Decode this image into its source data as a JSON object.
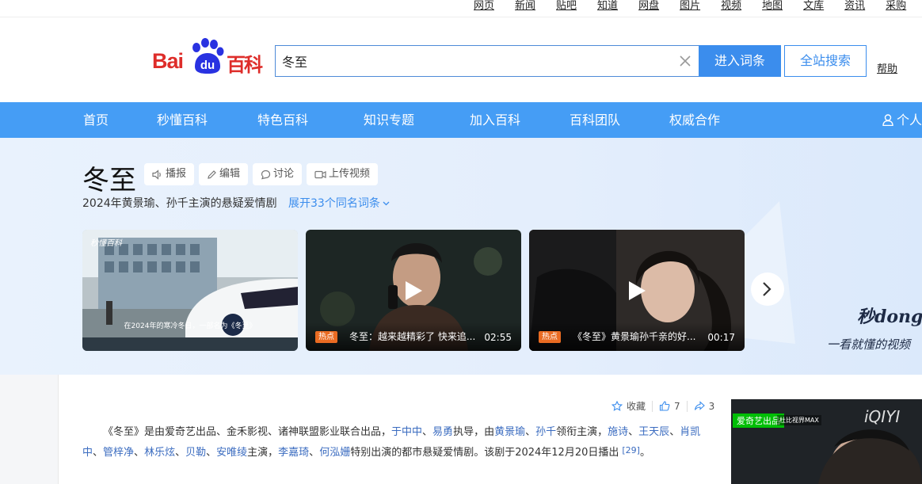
{
  "topnav": {
    "links": [
      "网页",
      "新闻",
      "贴吧",
      "知道",
      "网盘",
      "图片",
      "视频",
      "地图",
      "文库",
      "资讯",
      "采购"
    ]
  },
  "header": {
    "logo_text_left": "Bai",
    "logo_text_paw": "du",
    "logo_text_right": "百科",
    "search_value": "冬至",
    "enter_label": "进入词条",
    "site_search_label": "全站搜索",
    "help_label": "帮助"
  },
  "mainnav": {
    "items": [
      "首页",
      "秒懂百科",
      "特色百科",
      "知识专题",
      "加入百科",
      "百科团队",
      "权威合作"
    ],
    "user_label": "个人"
  },
  "entry": {
    "title": "冬至",
    "actions": [
      "播报",
      "编辑",
      "讨论",
      "上传视频"
    ],
    "subtitle": "2024年黄景瑜、孙千主演的悬疑爱情剧",
    "expand_label": "展开33个同名词条"
  },
  "videos": [
    {
      "brand": "秒懂百科",
      "subline": "在2024年的寒冷冬日，一部名为《冬至》",
      "hot": "",
      "title": "",
      "duration": ""
    },
    {
      "brand": "",
      "subline": "",
      "hot": "热点",
      "title": "冬至：越来越精彩了 快来追...",
      "duration": "02:55"
    },
    {
      "brand": "",
      "subline": "",
      "hot": "热点",
      "title": "《冬至》黄景瑜孙千亲的好...",
      "duration": "00:17"
    }
  ],
  "miaodong": {
    "logo": "秒dong百",
    "slogan": "一看就懂的视频"
  },
  "tools": {
    "favorite": "收藏",
    "likes": "7",
    "shares": "3"
  },
  "paragraph": {
    "p1": "《冬至》是由爱奇艺出品、金禾影视、诸神联盟影业联合出品，",
    "l1": "于中中",
    "s1": "、",
    "l2": "易勇",
    "p2": "执导，由",
    "l3": "黄景瑜",
    "s2": "、",
    "l4": "孙千",
    "p3": "领衔主演，",
    "l5": "施诗",
    "s3": "、",
    "l6": "王天辰",
    "s4": "、",
    "l7": "肖凯中",
    "s5": "、",
    "l8": "管梓净",
    "s6": "、",
    "l9": "林乐炫",
    "s7": "、",
    "l10": "贝勒",
    "s8": "、",
    "l11": "安唯绫",
    "p4": "主演，",
    "l12": "李嘉琦",
    "s9": "、",
    "l13": "何泓姗",
    "p5": "特别出演的都市悬疑爱情剧。该剧于2024年12月20日播出",
    "ref": "[29]",
    "end": "。"
  },
  "sidead": {
    "tag1": "爱奇艺出品",
    "tag2": "杜比视界MAX",
    "logo": "iQIYI"
  },
  "colors": {
    "brand_red": "#de2d2a",
    "brand_blue": "#3b8ded",
    "nav_blue": "#459df5"
  }
}
